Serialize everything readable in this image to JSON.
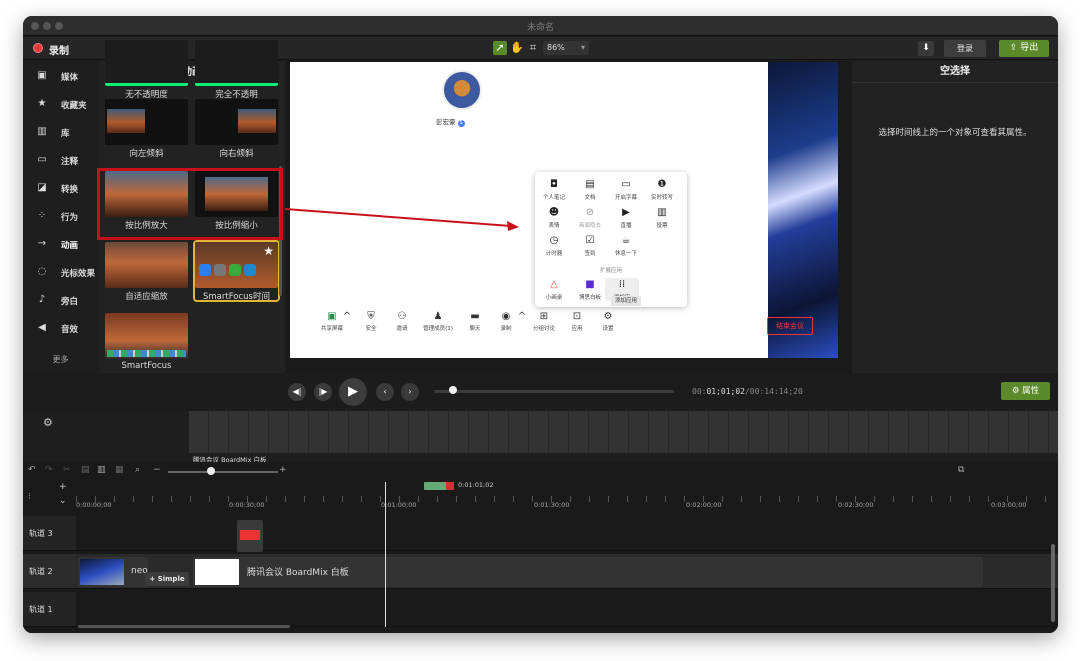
{
  "window": {
    "title": "未命名"
  },
  "toolbar": {
    "record_label": "录制",
    "zoom": "86%",
    "login_label": "登录",
    "export_label": "导出"
  },
  "sidebar": {
    "items": [
      {
        "label": "媒体",
        "icon": "film-icon"
      },
      {
        "label": "收藏夹",
        "icon": "star-icon"
      },
      {
        "label": "库",
        "icon": "library-icon"
      },
      {
        "label": "注释",
        "icon": "annotation-icon"
      },
      {
        "label": "转换",
        "icon": "transition-icon"
      },
      {
        "label": "行为",
        "icon": "behavior-icon"
      },
      {
        "label": "动画",
        "icon": "animation-icon"
      },
      {
        "label": "光标效果",
        "icon": "cursor-icon"
      },
      {
        "label": "旁白",
        "icon": "microphone-icon"
      },
      {
        "label": "音效",
        "icon": "speaker-icon"
      }
    ],
    "more_label": "更多",
    "active_index": 6
  },
  "animations": {
    "title": "动画",
    "cards": [
      {
        "label": "无不透明度"
      },
      {
        "label": "完全不透明"
      },
      {
        "label": "向左倾斜"
      },
      {
        "label": "向右倾斜"
      },
      {
        "label": "按比例放大"
      },
      {
        "label": "按比例缩小"
      },
      {
        "label": "自适应缩放"
      },
      {
        "label": "SmartFocus时间"
      },
      {
        "label": "SmartFocus"
      }
    ]
  },
  "preview": {
    "user_name": "彭宏豪",
    "popup": {
      "items": [
        {
          "label": "个人笔记",
          "icon": "note-icon"
        },
        {
          "label": "文档",
          "icon": "document-icon"
        },
        {
          "label": "开启字幕",
          "icon": "caption-icon"
        },
        {
          "label": "实时转写",
          "icon": "transcribe-icon"
        },
        {
          "label": "表情",
          "icon": "emoji-icon"
        },
        {
          "label": "画面隐去",
          "icon": "hide-icon"
        },
        {
          "label": "直播",
          "icon": "live-icon"
        },
        {
          "label": "投票",
          "icon": "vote-icon"
        },
        {
          "label": "计时器",
          "icon": "timer-icon"
        },
        {
          "label": "签到",
          "icon": "checkin-icon"
        },
        {
          "label": "休息一下",
          "icon": "coffee-icon"
        }
      ],
      "section_label": "扩展应用",
      "apps": [
        {
          "label": "小画桌",
          "icon": "triangle-app-icon"
        },
        {
          "label": "博思白板",
          "icon": "boardmix-icon"
        },
        {
          "label": "添加应",
          "icon": "add-app-icon"
        }
      ],
      "tooltip": "添加应用"
    },
    "meeting_bar": [
      {
        "label": "共享屏幕",
        "icon": "share-screen-icon"
      },
      {
        "label": "安全",
        "icon": "shield-icon"
      },
      {
        "label": "邀请",
        "icon": "invite-icon"
      },
      {
        "label": "管理成员(1)",
        "icon": "members-icon"
      },
      {
        "label": "聊天",
        "icon": "chat-icon"
      },
      {
        "label": "录制",
        "icon": "record-icon"
      },
      {
        "label": "分组讨论",
        "icon": "breakout-icon"
      },
      {
        "label": "应用",
        "icon": "apps-icon"
      },
      {
        "label": "设置",
        "icon": "gear-icon"
      }
    ],
    "end_meeting_label": "结束会议"
  },
  "properties": {
    "title": "空选择",
    "message": "选择时间线上的一个对象可查看其属性。"
  },
  "transport": {
    "timecode_current": "01;01;02",
    "timecode_prefix": "00:",
    "timecode_total": "/00:14:14;20",
    "properties_label": "属性",
    "progress": 0.08
  },
  "strip": {
    "label": "腾讯会议 BoardMix 白板"
  },
  "timeline": {
    "playhead_time": "0:01:01;02",
    "ruler_labels": [
      "0:00:00;00",
      "0:00:30;00",
      "0:01:00;00",
      "0:01:30;00",
      "0:02:00;00",
      "0:02:30;00",
      "0:03:00;00"
    ],
    "tracks": [
      {
        "label": "轨道 3"
      },
      {
        "label": "轨道 2",
        "clip_text": "neo",
        "clip_tag": "+ Simple",
        "clip_name": "腾讯会议 BoardMix 白板"
      },
      {
        "label": "轨道 1"
      }
    ]
  },
  "colors": {
    "accent_green": "#5a8a2a",
    "record_red": "#e63a3a",
    "highlight_red": "#c8101c"
  }
}
